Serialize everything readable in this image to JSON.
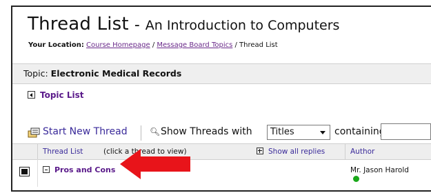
{
  "header": {
    "title": "Thread List",
    "dash": "-",
    "course": "An Introduction to Computers",
    "location_label": "Your Location:",
    "breadcrumbs": [
      "Course Homepage",
      "Message Board Topics",
      "Thread List"
    ],
    "breadcrumb_sep": " / "
  },
  "topic": {
    "label": "Topic:",
    "value": "Electronic Medical Records",
    "list_link": "Topic List"
  },
  "toolbar": {
    "new_thread": "Start New Thread",
    "show_threads": "Show Threads with",
    "filter_selected": "Titles",
    "containing": "containing",
    "search_value": ""
  },
  "columns": {
    "thread_list": "Thread List",
    "note": "(click a thread to view)",
    "show_all": "Show all replies",
    "author": "Author"
  },
  "threads": [
    {
      "title": "Pros and Cons",
      "author": "Mr. Jason Harold"
    }
  ],
  "colors": {
    "link": "#5a1a8a",
    "header_link": "#3a2a9a",
    "arrow": "#e8141a",
    "online": "#1aa81a"
  }
}
